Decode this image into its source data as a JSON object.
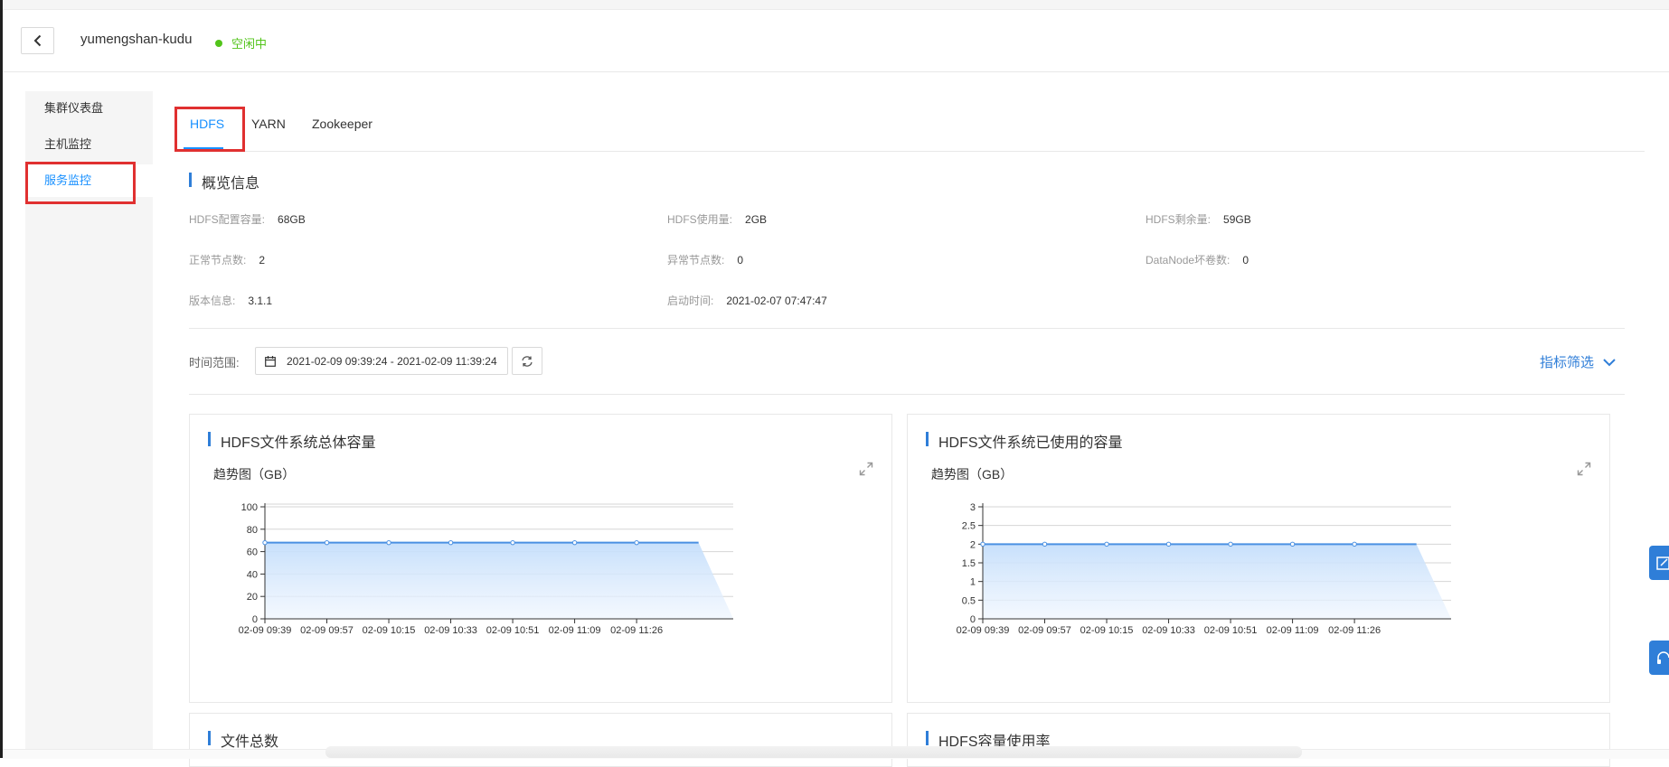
{
  "header": {
    "cluster_name": "yumengshan-kudu",
    "status": "空闲中",
    "status_color": "#52c41a"
  },
  "sidebar": {
    "items": [
      {
        "label": "集群仪表盘"
      },
      {
        "label": "主机监控"
      },
      {
        "label": "服务监控",
        "active": true
      }
    ]
  },
  "tabs": [
    {
      "label": "HDFS",
      "active": true
    },
    {
      "label": "YARN"
    },
    {
      "label": "Zookeeper"
    }
  ],
  "overview": {
    "title": "概览信息",
    "rows": [
      [
        {
          "label": "HDFS配置容量:",
          "value": "68GB"
        },
        {
          "label": "HDFS使用量:",
          "value": "2GB"
        },
        {
          "label": "HDFS剩余量:",
          "value": "59GB"
        }
      ],
      [
        {
          "label": "正常节点数:",
          "value": "2"
        },
        {
          "label": "异常节点数:",
          "value": "0"
        },
        {
          "label": "DataNode坏卷数:",
          "value": "0"
        }
      ],
      [
        {
          "label": "版本信息:",
          "value": "3.1.1"
        },
        {
          "label": "启动时间:",
          "value": "2021-02-07 07:47:47"
        }
      ]
    ]
  },
  "time_filter": {
    "label": "时间范围:",
    "range": "2021-02-09 09:39:24 - 2021-02-09 11:39:24",
    "metric_filter": "指标筛选"
  },
  "accent_color": "#2f7ed8",
  "chart_data": [
    {
      "type": "area",
      "title": "HDFS文件系统总体容量",
      "subtitle": "趋势图（GB）",
      "categories": [
        "02-09 09:39",
        "02-09 09:57",
        "02-09 10:15",
        "02-09 10:33",
        "02-09 10:51",
        "02-09 11:09",
        "02-09 11:26"
      ],
      "series": [
        {
          "values": [
            68,
            68,
            68,
            68,
            68,
            68,
            68,
            68
          ]
        }
      ],
      "yticks": [
        "0",
        "20",
        "40",
        "60",
        "80",
        "100"
      ],
      "ylim": [
        0,
        100
      ],
      "grid": true
    },
    {
      "type": "area",
      "title": "HDFS文件系统已使用的容量",
      "subtitle": "趋势图（GB）",
      "categories": [
        "02-09 09:39",
        "02-09 09:57",
        "02-09 10:15",
        "02-09 10:33",
        "02-09 10:51",
        "02-09 11:09",
        "02-09 11:26"
      ],
      "series": [
        {
          "values": [
            2,
            2,
            2,
            2,
            2,
            2,
            2,
            2
          ]
        }
      ],
      "yticks": [
        "0",
        "0.5",
        "1",
        "1.5",
        "2",
        "2.5",
        "3"
      ],
      "ylim": [
        0,
        3
      ],
      "grid": true
    }
  ],
  "bottom_cards": [
    {
      "title": "文件总数"
    },
    {
      "title": "HDFS容量使用率"
    }
  ]
}
